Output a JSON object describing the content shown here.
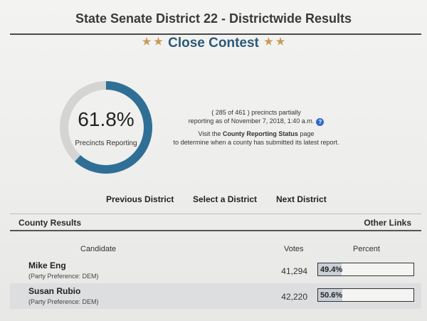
{
  "header": {
    "title": "State Senate District 22 - Districtwide Results",
    "badge": "Close Contest",
    "star_glyph": "★"
  },
  "reporting": {
    "percent_value": 61.8,
    "percent_label": "61.8%",
    "label": "Precincts Reporting",
    "status_line1": "( 285 of 461 ) precincts partially",
    "status_line2": "reporting as of November 7, 2018, 1:40 a.m.",
    "help_icon_glyph": "?",
    "visit_prefix": "Visit the ",
    "visit_link": "County Reporting Status",
    "visit_suffix": " page",
    "visit_line2": "to determine when a county has submitted its latest report."
  },
  "nav": {
    "previous": "Previous District",
    "select": "Select a District",
    "next": "Next District"
  },
  "section": {
    "left": "County Results",
    "right": "Other Links"
  },
  "table": {
    "headers": {
      "candidate": "Candidate",
      "votes": "Votes",
      "percent": "Percent"
    },
    "rows": [
      {
        "name": "Mike Eng",
        "party": "(Party Preference: DEM)",
        "votes": "41,294",
        "percent_label": "49.4%",
        "percent": 49.4
      },
      {
        "name": "Susan Rubio",
        "party": "(Party Preference: DEM)",
        "votes": "42,220",
        "percent_label": "50.6%",
        "percent": 50.6
      }
    ]
  },
  "colors": {
    "accent": "#2d5a78",
    "ring_fill": "#2f6f96",
    "ring_track": "#d4d4d2",
    "star": "#c99a57",
    "bar_fill": "#c9d0d8"
  },
  "icons": {
    "star": "star-icon",
    "help": "question-circle-icon"
  }
}
